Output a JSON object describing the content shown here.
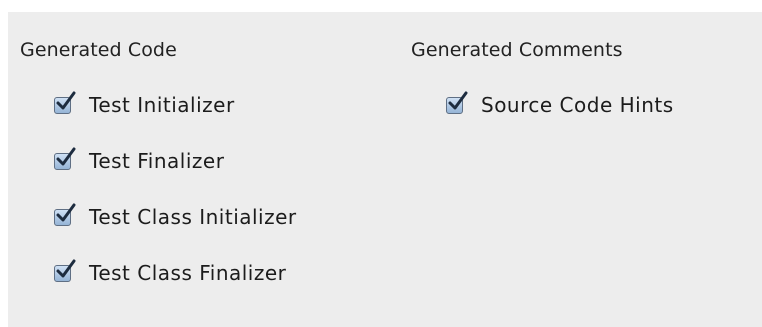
{
  "generated_code": {
    "title": "Generated Code",
    "options": [
      {
        "label": "Test Initializer",
        "checked": true
      },
      {
        "label": "Test Finalizer",
        "checked": true
      },
      {
        "label": "Test Class Initializer",
        "checked": true
      },
      {
        "label": "Test Class Finalizer",
        "checked": true
      }
    ]
  },
  "generated_comments": {
    "title": "Generated Comments",
    "options": [
      {
        "label": "Source Code Hints",
        "checked": true
      }
    ]
  },
  "colors": {
    "panel_background": "#ededed",
    "checkbox_fill": "#95b4d6",
    "checkmark": "#1d2c3f"
  }
}
